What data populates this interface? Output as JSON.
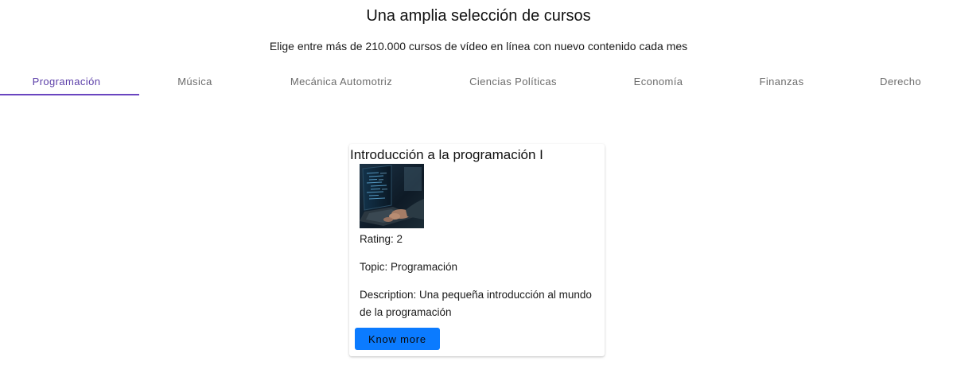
{
  "header": {
    "title": "Una amplia selección de cursos",
    "subtitle": "Elige entre más de 210.000 cursos de vídeo en línea con nuevo contenido cada mes"
  },
  "tabs": [
    {
      "label": "Programación",
      "active": true
    },
    {
      "label": "Música",
      "active": false
    },
    {
      "label": "Mecánica Automotriz",
      "active": false
    },
    {
      "label": "Ciencias Políticas",
      "active": false
    },
    {
      "label": "Economía",
      "active": false
    },
    {
      "label": "Finanzas",
      "active": false
    },
    {
      "label": "Derecho",
      "active": false
    }
  ],
  "course_card": {
    "title": "Introducción a la programación I",
    "image_icon": "laptop-code-photo",
    "rating": "Rating: 2",
    "topic": "Topic: Programación",
    "description": "Description: Una pequeña introducción al mundo de la programación",
    "button_label": "Know more"
  },
  "colors": {
    "accent": "#6a45c0",
    "active_tab_text": "#5b3ea8",
    "button_bg": "#0b7bff"
  }
}
